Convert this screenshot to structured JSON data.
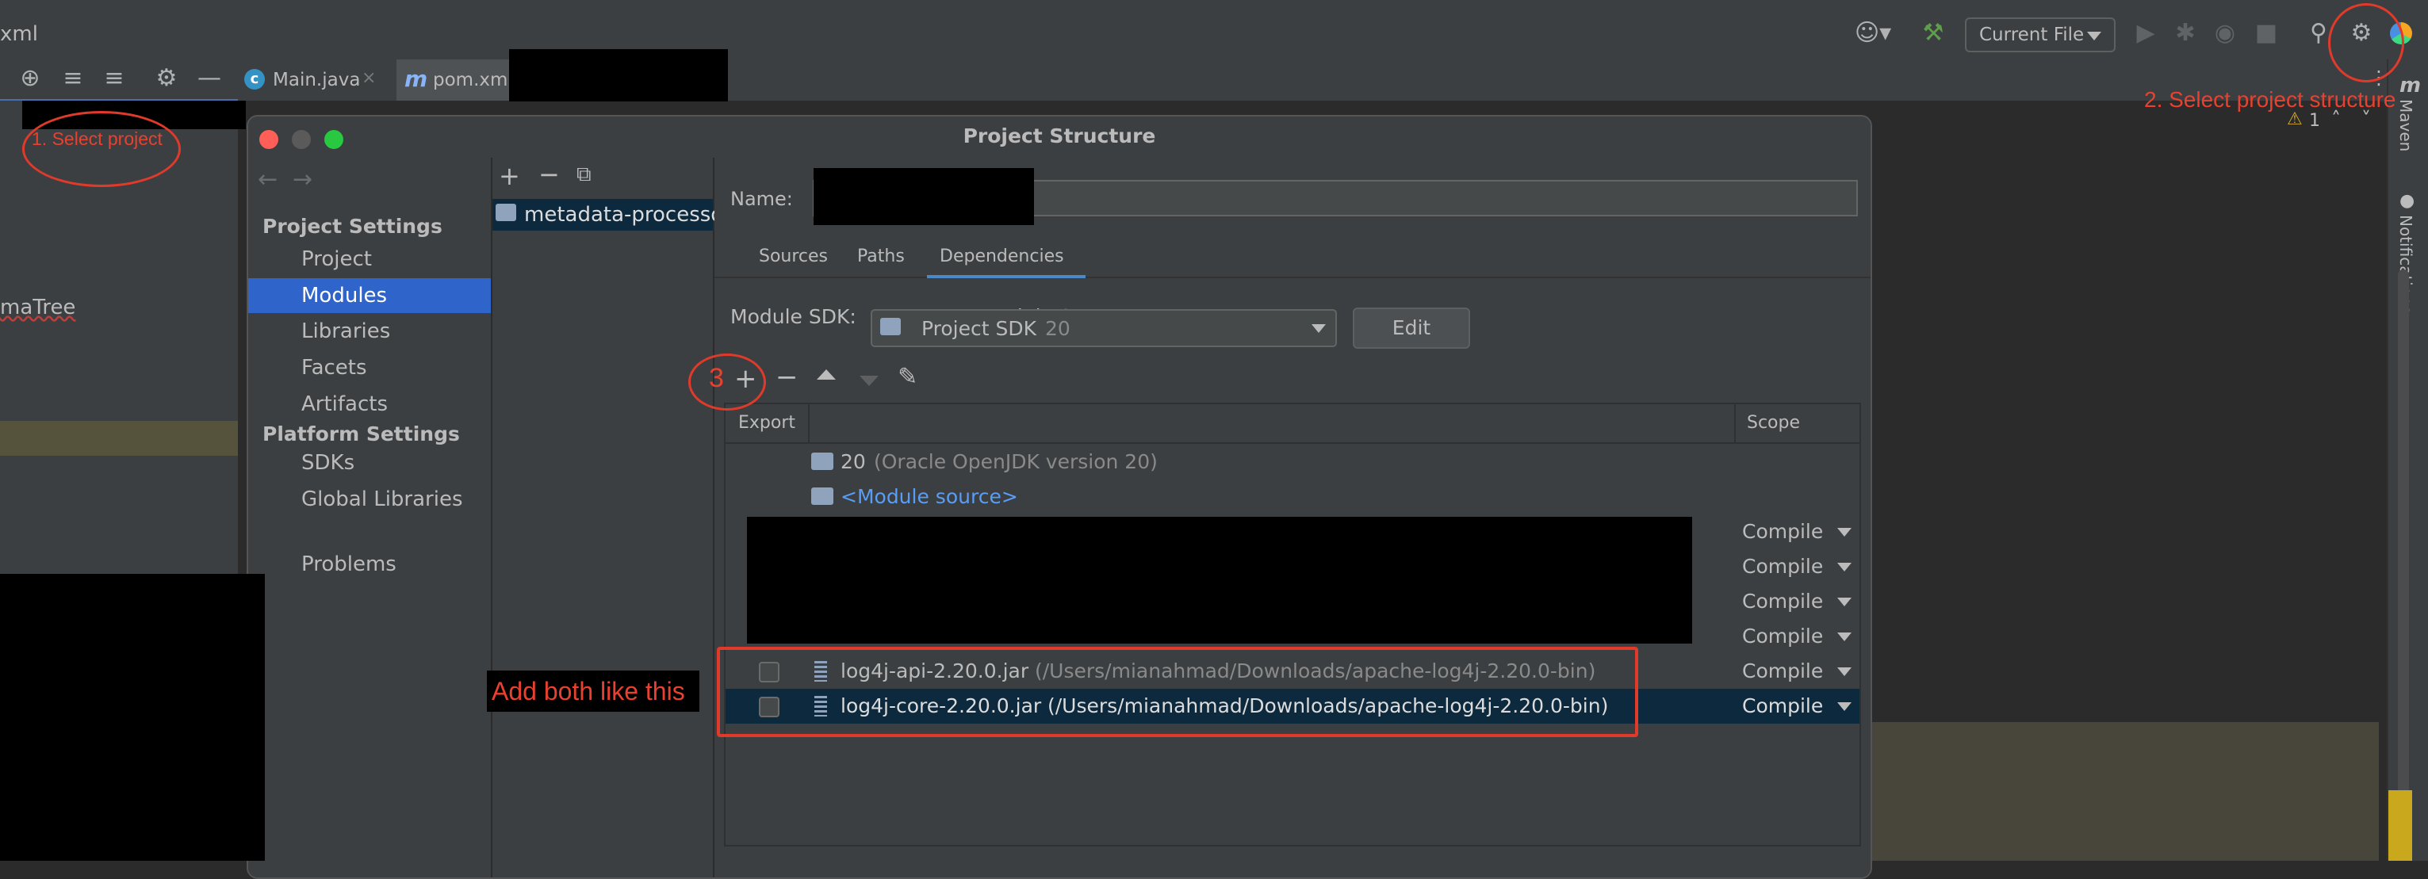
{
  "window": {
    "file_name_fragment": "xml"
  },
  "toolbar": {
    "run_config": "Current File"
  },
  "editor_tabs": [
    {
      "label": "Main.java"
    },
    {
      "label": "pom.xml"
    }
  ],
  "ide_left": {
    "tree_fragment": "maTree"
  },
  "right_strip": {
    "maven": "Maven",
    "notifications": "Notifications",
    "warnings": "1"
  },
  "dialog": {
    "title": "Project Structure",
    "nav": {
      "project_settings_header": "Project Settings",
      "project_settings": [
        "Project",
        "Modules",
        "Libraries",
        "Facets",
        "Artifacts"
      ],
      "platform_settings_header": "Platform Settings",
      "platform_settings": [
        "SDKs",
        "Global Libraries"
      ],
      "problems": "Problems"
    },
    "module_name": "metadata-processo",
    "name_label": "Name:",
    "tabs": [
      "Sources",
      "Paths",
      "Dependencies"
    ],
    "active_tab": "Dependencies",
    "module_sdk_label": "Module SDK:",
    "module_sdk_value": "Project SDK",
    "module_sdk_version": "20",
    "edit_button": "Edit",
    "table_headers": {
      "export": "Export",
      "scope": "Scope"
    },
    "sdk_entry": {
      "name": "20",
      "detail": "(Oracle OpenJDK version 20)"
    },
    "module_source": "<Module source>",
    "hidden_scopes": [
      "Compile",
      "Compile",
      "Compile",
      "Compile"
    ],
    "dependencies": [
      {
        "jar": "log4j-api-2.20.0.jar",
        "path": "(/Users/mianahmad/Downloads/apache-log4j-2.20.0-bin)",
        "scope": "Compile"
      },
      {
        "jar": "log4j-core-2.20.0.jar",
        "path": "(/Users/mianahmad/Downloads/apache-log4j-2.20.0-bin)",
        "scope": "Compile"
      }
    ]
  },
  "annotations": {
    "step1": "1. Select project",
    "step2": "2. Select project structure",
    "step3": "3",
    "add_note": "Add both like this"
  },
  "colors": {
    "accent": "#2f65ca",
    "annotation": "#e03a2b",
    "link": "#589df6"
  }
}
